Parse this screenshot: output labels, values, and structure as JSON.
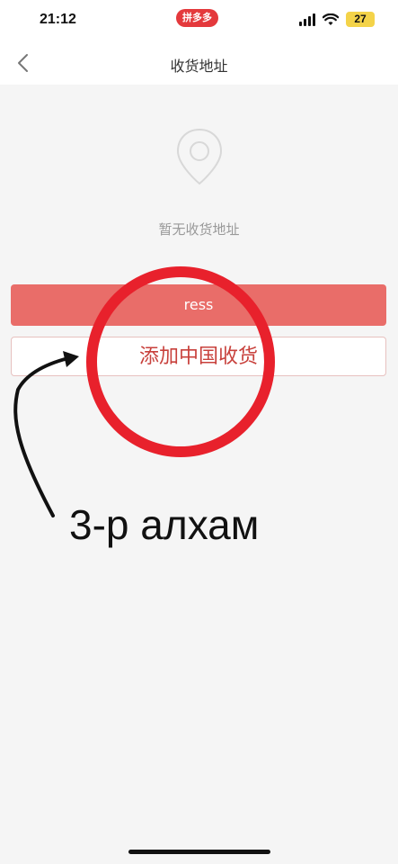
{
  "status_bar": {
    "time": "21:12",
    "app_badge": "拼多多",
    "battery": "27",
    "icons": [
      "signal-icon",
      "wifi-icon",
      "battery-icon"
    ]
  },
  "nav": {
    "title": "收货地址",
    "back_icon": "chevron-left-icon"
  },
  "empty_state": {
    "icon": "location-pin-icon",
    "message": "暂无收货地址"
  },
  "buttons": {
    "primary_label": "ress",
    "secondary_label": "添加中国收货"
  },
  "annotation": {
    "text": "3-р алхам",
    "circle_color": "#e8212c",
    "arrow_color": "#111111"
  },
  "colors": {
    "primary_button": "#e96d69",
    "secondary_text": "#c8413c",
    "badge": "#e4393c",
    "battery": "#f4d349"
  }
}
